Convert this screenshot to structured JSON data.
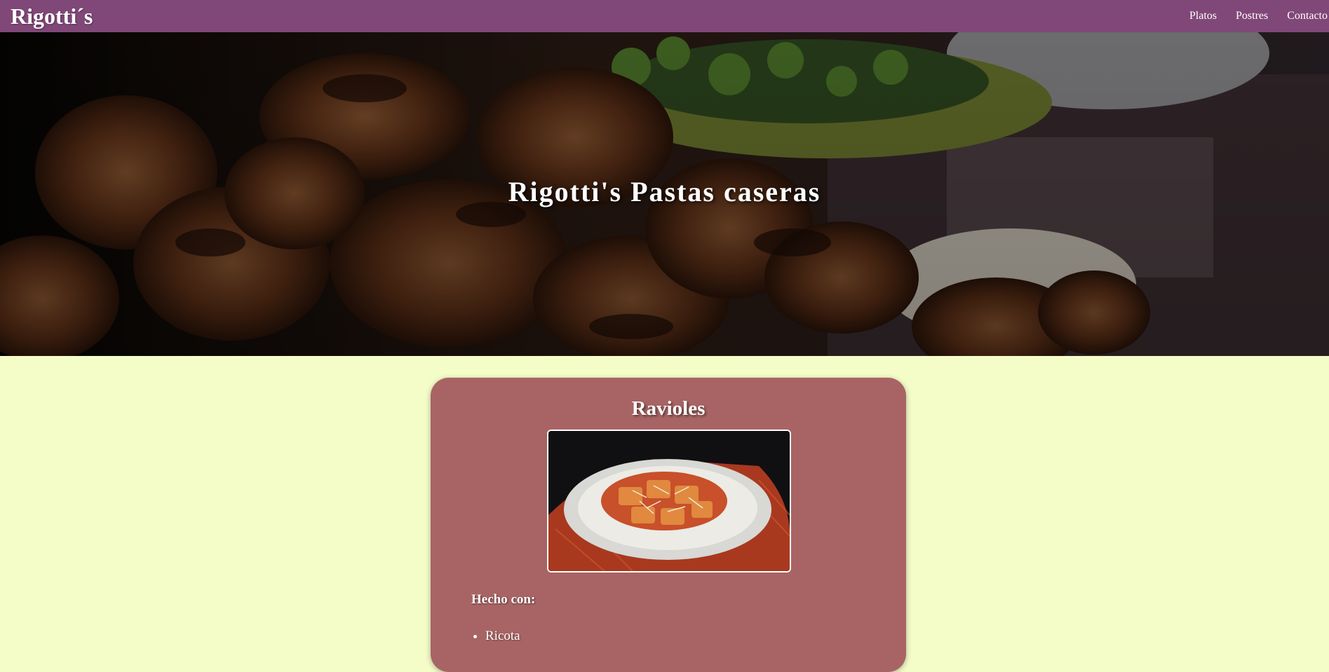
{
  "navbar": {
    "brand": "Rigotti´s",
    "links": [
      {
        "label": "Platos"
      },
      {
        "label": "Postres"
      },
      {
        "label": "Contacto"
      }
    ],
    "background": "#804878"
  },
  "hero": {
    "title": "Rigotti's Pastas caseras"
  },
  "card": {
    "title": "Ravioles",
    "ingredients_heading": "Hecho con:",
    "ingredients": [
      "Ricota"
    ],
    "background": "#a86464"
  },
  "page": {
    "background": "#f4fcc8"
  }
}
